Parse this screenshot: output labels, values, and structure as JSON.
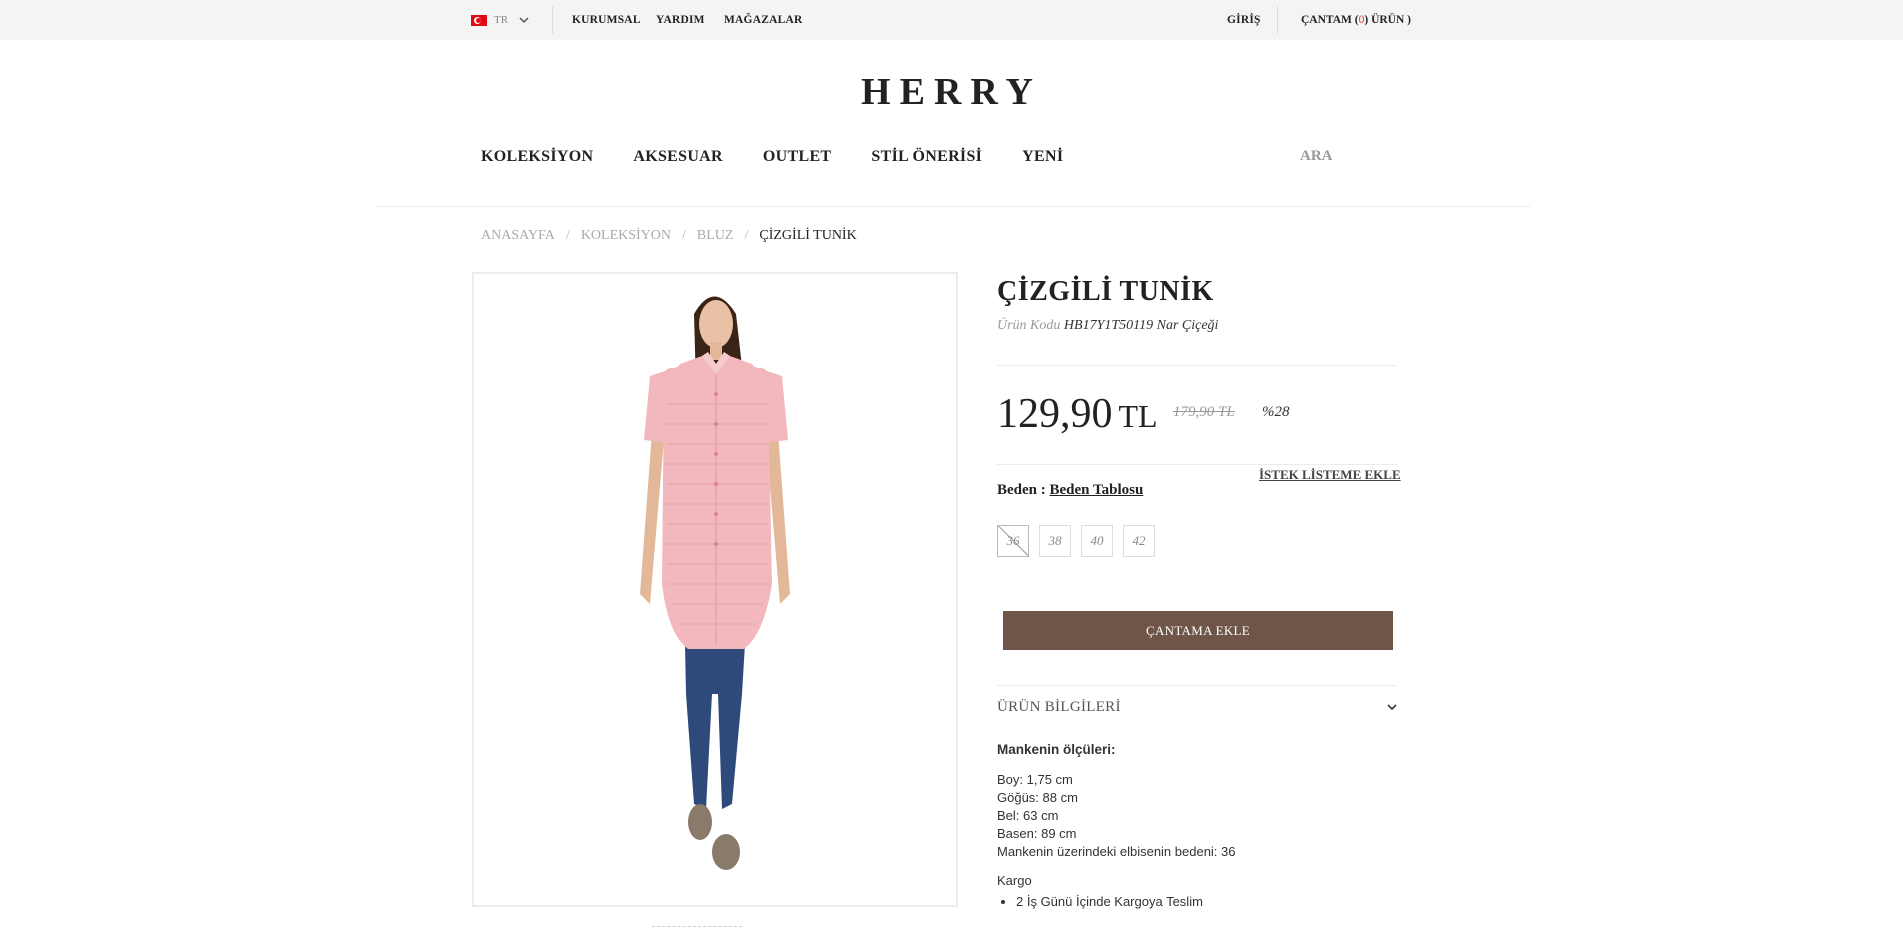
{
  "topbar": {
    "language": "TR",
    "links": [
      "KURUMSAL",
      "YARDIM",
      "MAĞAZALAR"
    ],
    "login": "GİRİŞ",
    "cart": {
      "label_prefix": "ÇANTAM (",
      "count": "0",
      "label_suffix": ") ÜRÜN )"
    }
  },
  "logo": "HERRY",
  "nav": {
    "items": [
      "KOLEKSİYON",
      "AKSESUAR",
      "OUTLET",
      "STİL ÖNERİSİ",
      "YENİ"
    ],
    "search": "ARA"
  },
  "breadcrumb": {
    "items": [
      "ANASAYFA",
      "KOLEKSİYON",
      "BLUZ"
    ],
    "separator": "/",
    "current": "ÇİZGİLİ TUNİK"
  },
  "product": {
    "title": "ÇİZGİLİ TUNİK",
    "code_label": "Ürün Kodu",
    "code_value": "HB17Y1T50119 Nar Çiçeği",
    "price": "129,90",
    "currency": "TL",
    "old_price": "179,90 TL",
    "discount": "%28",
    "wishlist": "İSTEK LİSTEME EKLE",
    "size_label": "Beden :",
    "size_table": "Beden Tablosu",
    "sizes": [
      {
        "label": "36",
        "available": false
      },
      {
        "label": "38",
        "available": true
      },
      {
        "label": "40",
        "available": true
      },
      {
        "label": "42",
        "available": true
      }
    ],
    "add_to_cart": "ÇANTAMA EKLE",
    "accordion_title": "ÜRÜN BİLGİLERİ"
  },
  "details": {
    "heading": "Mankenin ölçüleri:",
    "measurements": [
      "Boy: 1,75 cm",
      "Göğüs: 88 cm",
      "Bel: 63 cm",
      "Basen: 89 cm",
      "Mankenin üzerindeki elbisenin bedeni: 36"
    ],
    "cargo_label": "Kargo",
    "cargo_items": [
      "2 İş Günü İçinde Kargoya Teslim"
    ]
  },
  "colors": {
    "accent": "#6e5548",
    "topbar_bg": "#f4f4f4",
    "cart_count": "#e03030",
    "blouse": "#f2b8bd",
    "jeans": "#2e4a7a"
  }
}
